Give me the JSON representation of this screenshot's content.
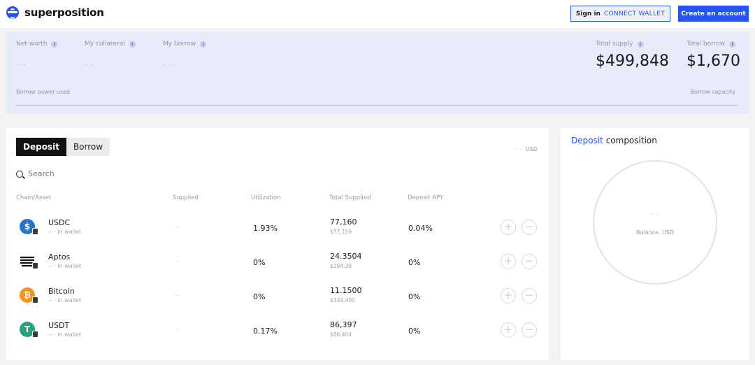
{
  "header": {
    "brand": "superposition",
    "signin_label": "Sign in",
    "connect_label": "CONNECT WALLET",
    "create_label": "Create an account"
  },
  "summary": {
    "net_worth_label": "Net worth",
    "net_worth_value": "- -",
    "collateral_label": "My collateral",
    "collateral_value": "- -",
    "borrow_label": "My borrow",
    "borrow_value": "- -",
    "total_supply_label": "Total supply",
    "total_supply_value": "$499,848",
    "total_borrow_label": "Total borrow",
    "total_borrow_value": "$1,670",
    "borrow_power_label": "Borrow power used",
    "borrow_capacity_label": "Borrow capacity",
    "info_glyph": "i"
  },
  "main": {
    "tabs": [
      {
        "label": "Deposit"
      },
      {
        "label": "Borrow"
      }
    ],
    "usd_toggle_value": "- -",
    "usd_toggle_unit": "USD",
    "search_placeholder": "Search",
    "columns": {
      "asset": "Chain/Asset",
      "supplied": "Supplied",
      "utilization": "Utilization",
      "total_supplied": "Total Supplied",
      "apy": "Deposit APY"
    },
    "rows": [
      {
        "name": "USDC",
        "wallet": "-- · in wallet",
        "supplied": "--",
        "utilization": "1.93%",
        "total_supplied": "77,160",
        "total_supplied_usd": "$77,159",
        "apy": "0.04%",
        "icon": "usdc-icon",
        "color": "#2775ca"
      },
      {
        "name": "Aptos",
        "wallet": "-- · in wallet",
        "supplied": "--",
        "utilization": "0%",
        "total_supplied": "24.3504",
        "total_supplied_usd": "$184.39",
        "apy": "0%",
        "icon": "aptos-icon",
        "color": "#111111"
      },
      {
        "name": "Bitcoin",
        "wallet": "-- · in wallet",
        "supplied": "--",
        "utilization": "0%",
        "total_supplied": "11.1500",
        "total_supplied_usd": "$334,400",
        "apy": "0%",
        "icon": "bitcoin-icon",
        "color": "#f7931a"
      },
      {
        "name": "USDT",
        "wallet": "-- · in wallet",
        "supplied": "--",
        "utilization": "0.17%",
        "total_supplied": "86,397",
        "total_supplied_usd": "$86,404",
        "apy": "0%",
        "icon": "usdt-icon",
        "color": "#26a17b"
      }
    ],
    "plus_glyph": "+",
    "minus_glyph": "−"
  },
  "composition": {
    "title_accent": "Deposit",
    "title_rest": " composition",
    "value": "- -",
    "label": "Balance, USD"
  },
  "colors": {
    "accent": "#2453f0",
    "summary_bg": "#e8ebfa"
  }
}
